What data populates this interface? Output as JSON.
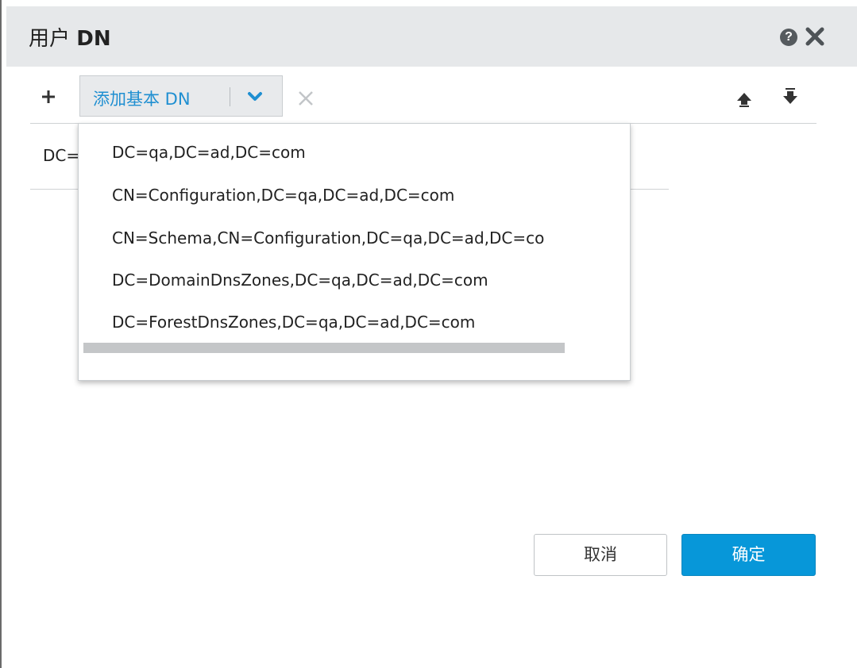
{
  "dialog": {
    "title_cn": "用户",
    "title_dn": "DN"
  },
  "header": {
    "help_icon": "question-circle-icon",
    "help_glyph": "?",
    "close_icon": "close-icon"
  },
  "toolbar": {
    "add_icon": "plus-icon",
    "add_base_dn_label": "添加基本 DN",
    "dropdown_icon": "chevron-down-icon",
    "delete_icon": "x-icon",
    "move_up_icon": "arrow-up-icon",
    "move_down_icon": "arrow-down-icon"
  },
  "list": {
    "items": [
      {
        "label": "DC="
      }
    ]
  },
  "dropdown": {
    "options": [
      "DC=qa,DC=ad,DC=com",
      "CN=Configuration,DC=qa,DC=ad,DC=com",
      "CN=Schema,CN=Configuration,DC=qa,DC=ad,DC=co",
      "DC=DomainDnsZones,DC=qa,DC=ad,DC=com",
      "DC=ForestDnsZones,DC=qa,DC=ad,DC=com"
    ]
  },
  "footer": {
    "cancel_label": "取消",
    "ok_label": "确定"
  },
  "colors": {
    "accent": "#0797d9",
    "link_blue": "#1f8fd1",
    "header_bg": "#e6e8ea"
  }
}
